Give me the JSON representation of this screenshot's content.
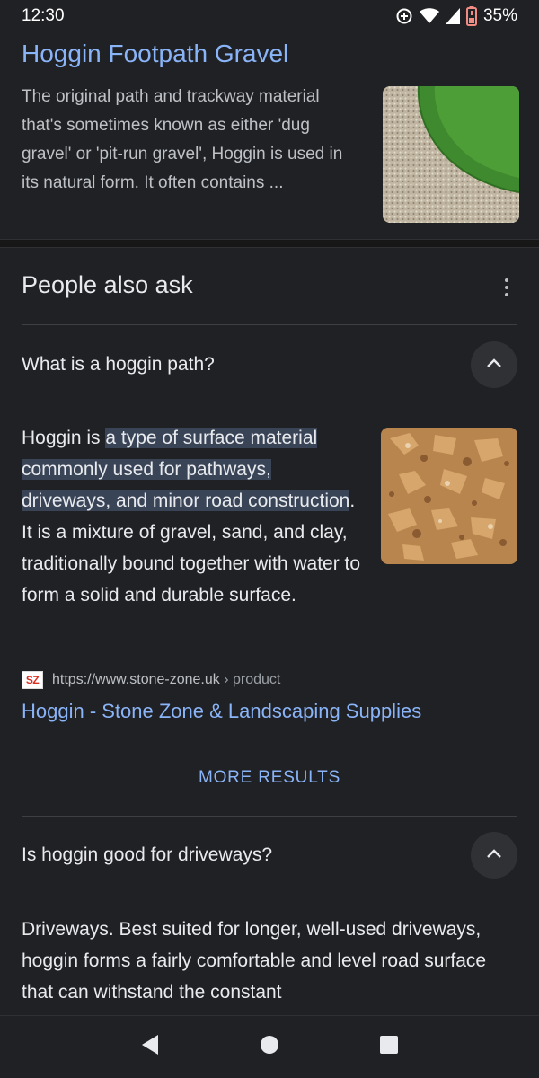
{
  "status_bar": {
    "time": "12:30",
    "battery": "35%"
  },
  "top_result": {
    "title": "Hoggin Footpath Gravel",
    "snippet": "The original path and trackway material that's sometimes known as either 'dug gravel' or 'pit-run gravel', Hoggin is used in its natural form. It often contains ..."
  },
  "paa": {
    "heading": "People also ask",
    "q1": {
      "question": "What is a hoggin path?",
      "answer_start": "Hoggin is ",
      "answer_highlight": "a type of surface material commonly used for pathways, driveways, and minor road construction",
      "answer_end": ". It is a mixture of gravel, sand, and clay, traditionally bound together with water to form a solid and durable surface.",
      "source_favicon": "SZ",
      "source_url": "https://www.stone-zone.uk",
      "source_crumb": " › product",
      "source_title": "Hoggin - Stone Zone & Landscaping Supplies",
      "more_results": "MORE RESULTS"
    },
    "q2": {
      "question": "Is hoggin good for driveways?",
      "answer": "Driveways. Best suited for longer, well-used driveways, hoggin forms a fairly comfortable and level road surface that can withstand the constant"
    }
  },
  "icons": [
    "data-saver-icon",
    "wifi-icon",
    "signal-icon",
    "battery-icon",
    "more-vert-icon",
    "chevron-up-icon",
    "back-icon",
    "home-icon",
    "recents-icon"
  ],
  "colors": {
    "background": "#202124",
    "link": "#8ab4f8",
    "highlight": "#394457"
  }
}
